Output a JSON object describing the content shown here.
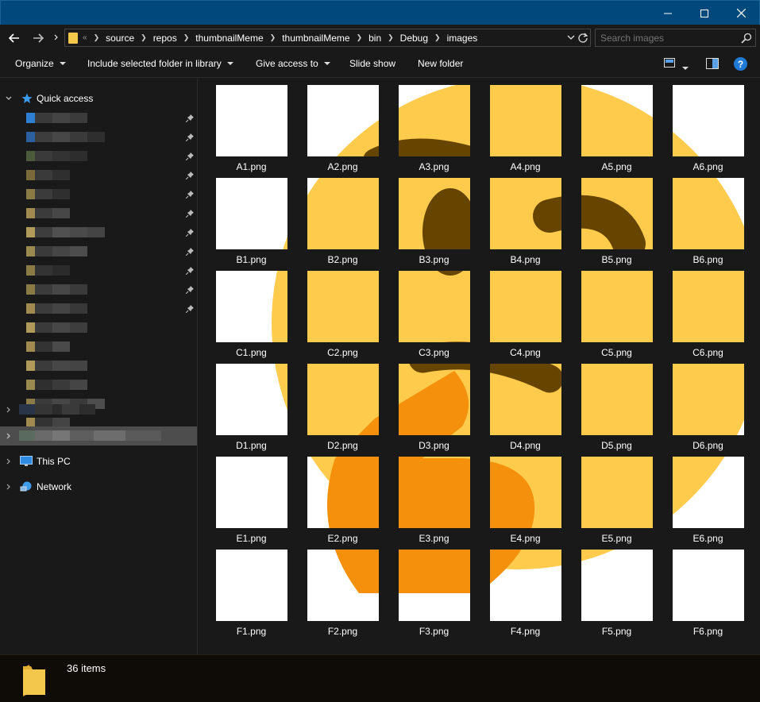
{
  "window": {
    "controls": {
      "minimize": "—",
      "maximize": "☐",
      "close": "✕"
    }
  },
  "address": {
    "overflow": "«",
    "crumbs": [
      "source",
      "repos",
      "thumbnailMeme",
      "thumbnailMeme",
      "bin",
      "Debug",
      "images"
    ]
  },
  "search": {
    "placeholder": "Search images"
  },
  "toolbar": {
    "organize": "Organize",
    "include_library": "Include selected folder in library",
    "give_access": "Give access to",
    "slide_show": "Slide show",
    "new_folder": "New folder",
    "help": "?"
  },
  "nav": {
    "quick_access": "Quick access",
    "this_pc": "This PC",
    "network": "Network"
  },
  "files": [
    "A1.png",
    "A2.png",
    "A3.png",
    "A4.png",
    "A5.png",
    "A6.png",
    "B1.png",
    "B2.png",
    "B3.png",
    "B4.png",
    "B5.png",
    "B6.png",
    "C1.png",
    "C2.png",
    "C3.png",
    "C4.png",
    "C5.png",
    "C6.png",
    "D1.png",
    "D2.png",
    "D3.png",
    "D4.png",
    "D5.png",
    "D6.png",
    "E1.png",
    "E2.png",
    "E3.png",
    "E4.png",
    "E5.png",
    "E6.png",
    "F1.png",
    "F2.png",
    "F3.png",
    "F4.png",
    "F5.png",
    "F6.png"
  ],
  "status": {
    "item_count": "36 items"
  },
  "colors": {
    "titlebar": "#00497d",
    "background": "#191919",
    "emoji_face": "#ffcb4c",
    "emoji_hand": "#f4900c",
    "emoji_features": "#664500",
    "folder": "#f3c64c",
    "accent": "#1f7ad6"
  }
}
